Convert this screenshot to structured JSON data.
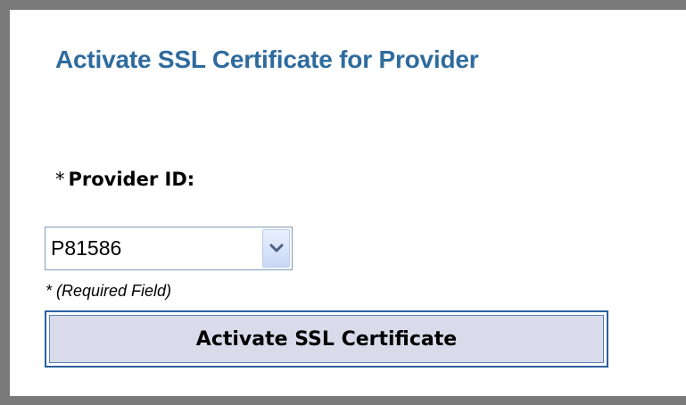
{
  "page": {
    "title": "Activate SSL Certificate for Provider"
  },
  "form": {
    "provider_id_label": {
      "required_marker": "*",
      "text": "Provider ID:"
    },
    "provider_select": {
      "selected_value": "P81586",
      "arrow_icon": "chevron-down-icon"
    },
    "required_note": "* (Required Field)",
    "submit_label": "Activate SSL Certificate"
  },
  "colors": {
    "heading": "#2e6b9e",
    "frame_border": "#7a7a7a",
    "button_fill": "#d9dbea",
    "button_border": "#2a5fa0"
  }
}
